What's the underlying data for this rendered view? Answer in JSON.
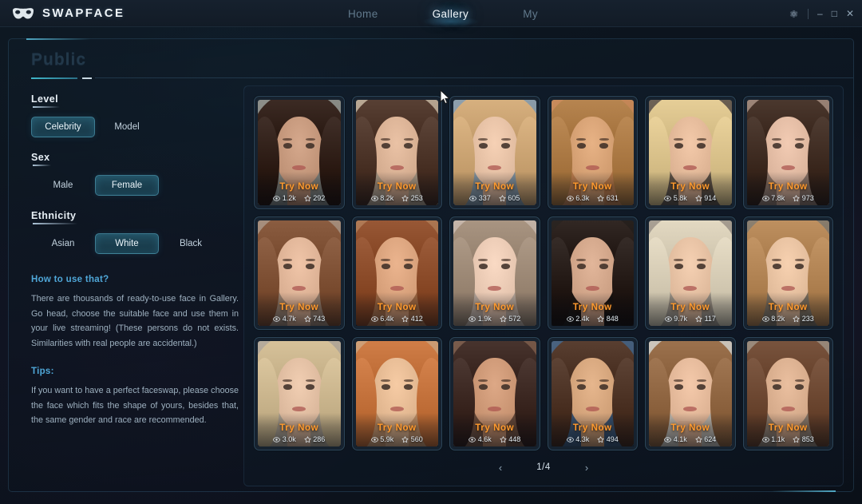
{
  "titlebar": {
    "brand": "SWAPFACE",
    "logo_icon": "mask-icon",
    "nav": [
      {
        "label": "Home",
        "active": false
      },
      {
        "label": "Gallery",
        "active": true
      },
      {
        "label": "My",
        "active": false
      }
    ],
    "window_controls": {
      "settings_icon": "gear-icon",
      "minimize": "–",
      "maximize": "□",
      "close": "✕"
    }
  },
  "sidebar": {
    "panel_title": "Public",
    "filters": [
      {
        "label": "Level",
        "options": [
          {
            "label": "Celebrity",
            "active": true
          },
          {
            "label": "Model",
            "active": false
          }
        ]
      },
      {
        "label": "Sex",
        "options": [
          {
            "label": "Male",
            "active": false
          },
          {
            "label": "Female",
            "active": true
          }
        ]
      },
      {
        "label": "Ethnicity",
        "options": [
          {
            "label": "Asian",
            "active": false
          },
          {
            "label": "White",
            "active": true
          },
          {
            "label": "Black",
            "active": false
          }
        ]
      }
    ],
    "help": {
      "heading": "How to use that?",
      "body": "There are thousands of ready-to-use face in Gallery. Go head, choose the suitable face and use them in your live streaming! (These persons do not exists. Similarities with real people are accidental.)"
    },
    "tips": {
      "heading": "Tips:",
      "body": "If you want to have a perfect faceswap, please choose the face which fits the shape of yours, besides that, the same gender and race are recommended."
    }
  },
  "gallery": {
    "try_now_label": "Try Now",
    "views_icon": "eye-icon",
    "likes_icon": "star-icon",
    "cards": [
      {
        "views": "1.2k",
        "likes": "292",
        "skin": "#c79a7e",
        "hair": "#2e1d16",
        "bg": "#8d8f8a"
      },
      {
        "views": "8.2k",
        "likes": "253",
        "skin": "#dcb497",
        "hair": "#4a3226",
        "bg": "#b9a894"
      },
      {
        "views": "337",
        "likes": "605",
        "skin": "#e8c3a7",
        "hair": "#c9a271",
        "bg": "#8fa0ad"
      },
      {
        "views": "6.3k",
        "likes": "631",
        "skin": "#d9a477",
        "hair": "#a97742",
        "bg": "#c98b5c"
      },
      {
        "views": "5.8k",
        "likes": "914",
        "skin": "#e5bb9b",
        "hair": "#d8c089",
        "bg": "#6e6256"
      },
      {
        "views": "7.8k",
        "likes": "973",
        "skin": "#e4bda5",
        "hair": "#3d2a20",
        "bg": "#9c8578"
      },
      {
        "views": "4.7k",
        "likes": "743",
        "skin": "#e2b79a",
        "hair": "#7d4f33",
        "bg": "#a78f7d"
      },
      {
        "views": "6.4k",
        "likes": "412",
        "skin": "#dda680",
        "hair": "#8a4a28",
        "bg": "#b07a55"
      },
      {
        "views": "1.9k",
        "likes": "572",
        "skin": "#ecccb6",
        "hair": "#9b8774",
        "bg": "#c6b6aa"
      },
      {
        "views": "2.4k",
        "likes": "848",
        "skin": "#d4a88c",
        "hair": "#241a16",
        "bg": "#2b2522"
      },
      {
        "views": "9.7k",
        "likes": "117",
        "skin": "#e7c2a4",
        "hair": "#d5cbb4",
        "bg": "#a9a094"
      },
      {
        "views": "8.2k",
        "likes": "233",
        "skin": "#e9c3a2",
        "hair": "#b08252",
        "bg": "#8c8070"
      },
      {
        "views": "3.0k",
        "likes": "286",
        "skin": "#e3c0a4",
        "hair": "#c9b48c",
        "bg": "#b7ac9c"
      },
      {
        "views": "5.9k",
        "likes": "560",
        "skin": "#e8bd96",
        "hair": "#c2703a",
        "bg": "#d0a077"
      },
      {
        "views": "4.6k",
        "likes": "448",
        "skin": "#cf9a78",
        "hair": "#3a2620",
        "bg": "#7a5c4c"
      },
      {
        "views": "4.3k",
        "likes": "494",
        "skin": "#d8a87f",
        "hair": "#4b3123",
        "bg": "#4a6380"
      },
      {
        "views": "4.1k",
        "likes": "624",
        "skin": "#e6bb9c",
        "hair": "#8e6440",
        "bg": "#cdc6bc"
      },
      {
        "views": "1.1k",
        "likes": "853",
        "skin": "#dcb191",
        "hair": "#6b4630",
        "bg": "#9b8b7c"
      }
    ],
    "pagination": {
      "prev_label": "‹",
      "page_text": "1/4",
      "next_label": "›"
    }
  },
  "theme": {
    "accent": "#3fb6c9",
    "try_now_color": "#ff9a2e",
    "active_chip": "#2c6a84",
    "background": "#0b131d"
  }
}
